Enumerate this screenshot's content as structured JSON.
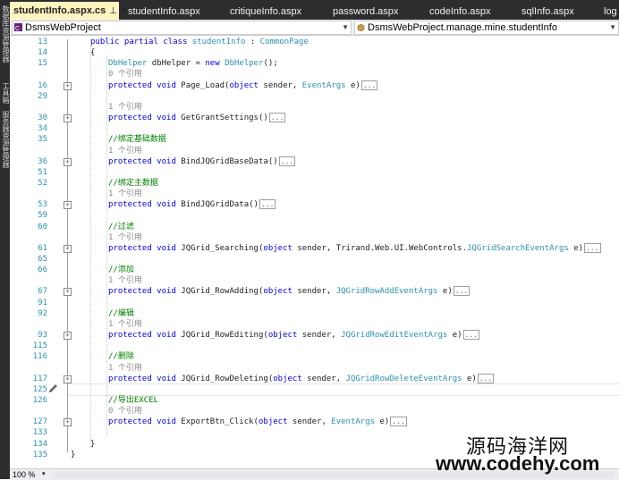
{
  "left_strip": {
    "texts": [
      "数据库资源管理器",
      "工具箱",
      "服务器资源管理器"
    ]
  },
  "tabs": [
    {
      "label": "studentInfo.aspx.cs",
      "active": true,
      "pin": "⊥",
      "close": "✕"
    },
    {
      "label": "studentInfo.aspx",
      "active": false
    },
    {
      "label": "critiqueInfo.aspx",
      "active": false
    },
    {
      "label": "password.aspx",
      "active": false
    },
    {
      "label": "codeInfo.aspx",
      "active": false
    },
    {
      "label": "sqlInfo.aspx",
      "active": false
    },
    {
      "label": "log",
      "active": false
    }
  ],
  "nav": {
    "project": "DsmsWebProject",
    "class": "DsmsWebProject.manage.mine.studentInfo"
  },
  "code_lines": [
    {
      "ln": "13",
      "fold": false,
      "parts": [
        [
          "kw",
          "public partial class "
        ],
        [
          "ty",
          "studentInfo"
        ],
        [
          "tx",
          " : "
        ],
        [
          "ty",
          "CommonPage"
        ]
      ]
    },
    {
      "ln": "14",
      "fold": false,
      "parts": [
        [
          "tx",
          "{"
        ]
      ]
    },
    {
      "ln": "15",
      "fold": false,
      "parts": [
        [
          "ty",
          "DbHelper"
        ],
        [
          "tx",
          " dbHelper = "
        ],
        [
          "kw",
          "new "
        ],
        [
          "ty",
          "DbHelper"
        ],
        [
          "tx",
          "();"
        ]
      ]
    },
    {
      "ln": "",
      "fold": false,
      "parts": [
        [
          "ref",
          "0 个引用"
        ]
      ]
    },
    {
      "ln": "16",
      "fold": true,
      "parts": [
        [
          "kw",
          "protected void "
        ],
        [
          "tx",
          "Page_Load("
        ],
        [
          "kw",
          "object "
        ],
        [
          "tx",
          "sender, "
        ],
        [
          "ty",
          "EventArgs "
        ],
        [
          "tx",
          "e)"
        ]
      ],
      "collapsed": "..."
    },
    {
      "ln": "29",
      "fold": false,
      "parts": []
    },
    {
      "ln": "",
      "fold": false,
      "parts": [
        [
          "ref",
          "1 个引用"
        ]
      ]
    },
    {
      "ln": "30",
      "fold": true,
      "parts": [
        [
          "kw",
          "protected void "
        ],
        [
          "tx",
          "GetGrantSettings()"
        ]
      ],
      "collapsed": "..."
    },
    {
      "ln": "34",
      "fold": false,
      "parts": []
    },
    {
      "ln": "35",
      "fold": false,
      "parts": [
        [
          "cm",
          "//绑定基础数据"
        ]
      ]
    },
    {
      "ln": "",
      "fold": false,
      "parts": [
        [
          "ref",
          "1 个引用"
        ]
      ]
    },
    {
      "ln": "36",
      "fold": true,
      "parts": [
        [
          "kw",
          "protected void "
        ],
        [
          "tx",
          "BindJQGridBaseData()"
        ]
      ],
      "collapsed": "..."
    },
    {
      "ln": "51",
      "fold": false,
      "parts": []
    },
    {
      "ln": "52",
      "fold": false,
      "parts": [
        [
          "cm",
          "//绑定主数据"
        ]
      ]
    },
    {
      "ln": "",
      "fold": false,
      "parts": [
        [
          "ref",
          "1 个引用"
        ]
      ]
    },
    {
      "ln": "53",
      "fold": true,
      "parts": [
        [
          "kw",
          "protected void "
        ],
        [
          "tx",
          "BindJQGridData()"
        ]
      ],
      "collapsed": "..."
    },
    {
      "ln": "59",
      "fold": false,
      "parts": []
    },
    {
      "ln": "60",
      "fold": false,
      "parts": [
        [
          "cm",
          "//过滤"
        ]
      ]
    },
    {
      "ln": "",
      "fold": false,
      "parts": [
        [
          "ref",
          "1 个引用"
        ]
      ]
    },
    {
      "ln": "61",
      "fold": true,
      "parts": [
        [
          "kw",
          "protected void "
        ],
        [
          "tx",
          "JQGrid_Searching("
        ],
        [
          "kw",
          "object "
        ],
        [
          "tx",
          "sender, Trirand.Web.UI.WebControls."
        ],
        [
          "ty",
          "JQGridSearchEventArgs"
        ],
        [
          "tx",
          " e)"
        ]
      ],
      "collapsed": "..."
    },
    {
      "ln": "65",
      "fold": false,
      "parts": []
    },
    {
      "ln": "66",
      "fold": false,
      "parts": [
        [
          "cm",
          "//添加"
        ]
      ]
    },
    {
      "ln": "",
      "fold": false,
      "parts": [
        [
          "ref",
          "1 个引用"
        ]
      ]
    },
    {
      "ln": "67",
      "fold": true,
      "parts": [
        [
          "kw",
          "protected void "
        ],
        [
          "tx",
          "JQGrid_RowAdding("
        ],
        [
          "kw",
          "object "
        ],
        [
          "tx",
          "sender, "
        ],
        [
          "ty",
          "JQGridRowAddEventArgs"
        ],
        [
          "tx",
          " e)"
        ]
      ],
      "collapsed": "..."
    },
    {
      "ln": "91",
      "fold": false,
      "parts": []
    },
    {
      "ln": "92",
      "fold": false,
      "parts": [
        [
          "cm",
          "//编辑"
        ]
      ]
    },
    {
      "ln": "",
      "fold": false,
      "parts": [
        [
          "ref",
          "1 个引用"
        ]
      ]
    },
    {
      "ln": "93",
      "fold": true,
      "parts": [
        [
          "kw",
          "protected void "
        ],
        [
          "tx",
          "JQGrid_RowEditing("
        ],
        [
          "kw",
          "object "
        ],
        [
          "tx",
          "sender, "
        ],
        [
          "ty",
          "JQGridRowEditEventArgs"
        ],
        [
          "tx",
          " e)"
        ]
      ],
      "collapsed": "..."
    },
    {
      "ln": "115",
      "fold": false,
      "parts": []
    },
    {
      "ln": "116",
      "fold": false,
      "parts": [
        [
          "cm",
          "//删除"
        ]
      ]
    },
    {
      "ln": "",
      "fold": false,
      "parts": [
        [
          "ref",
          "1 个引用"
        ]
      ]
    },
    {
      "ln": "117",
      "fold": true,
      "parts": [
        [
          "kw",
          "protected void "
        ],
        [
          "tx",
          "JQGrid_RowDeleting("
        ],
        [
          "kw",
          "object "
        ],
        [
          "tx",
          "sender, "
        ],
        [
          "ty",
          "JQGridRowDeleteEventArgs"
        ],
        [
          "tx",
          " e)"
        ]
      ],
      "collapsed": "..."
    },
    {
      "ln": "125",
      "fold": false,
      "parts": [],
      "current": true
    },
    {
      "ln": "126",
      "fold": false,
      "parts": [
        [
          "cm",
          "//导出EXCEL"
        ]
      ]
    },
    {
      "ln": "",
      "fold": false,
      "parts": [
        [
          "ref",
          "0 个引用"
        ]
      ]
    },
    {
      "ln": "127",
      "fold": true,
      "parts": [
        [
          "kw",
          "protected void "
        ],
        [
          "tx",
          "ExportBtn_Click("
        ],
        [
          "kw",
          "object "
        ],
        [
          "tx",
          "sender, "
        ],
        [
          "ty",
          "EventArgs "
        ],
        [
          "tx",
          "e)"
        ]
      ],
      "collapsed": "..."
    },
    {
      "ln": "133",
      "fold": false,
      "parts": []
    },
    {
      "ln": "134",
      "fold": false,
      "parts": [
        [
          "tx",
          "}"
        ]
      ],
      "outer": true
    },
    {
      "ln": "135",
      "fold": false,
      "parts": [
        [
          "tx",
          "}"
        ]
      ],
      "outermost": true
    }
  ],
  "status": {
    "zoom": "100 %",
    "zoom_arrow": "▾"
  },
  "watermark": {
    "line1": "源码海洋网",
    "line2": "www.codehy.com"
  }
}
